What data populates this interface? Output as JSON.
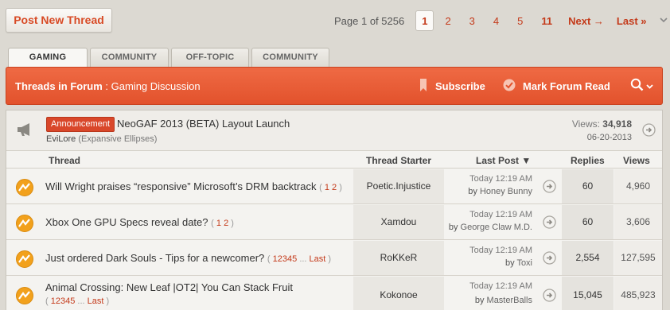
{
  "post_button": "Post New Thread",
  "pager": {
    "info": "Page 1 of 5256",
    "pages": [
      "1",
      "2",
      "3",
      "4",
      "5",
      "11"
    ],
    "next": "Next →",
    "last": "Last »",
    "chevron": "⌄"
  },
  "tabs": [
    "GAMING",
    "COMMUNITY",
    "OFF-TOPIC",
    "COMMUNITY"
  ],
  "forum_bar": {
    "prefix": "Threads in Forum",
    "separator": " : ",
    "forum_name": "Gaming Discussion",
    "subscribe": "Subscribe",
    "mark_read": "Mark Forum Read"
  },
  "announcement": {
    "badge": "Announcement",
    "title": "NeoGAF 2013 (BETA) Layout Launch",
    "author": "EviLore",
    "author_sub": "(Expansive Ellipses)",
    "views_label": "Views:",
    "views": "34,918",
    "date": "06-20-2013"
  },
  "columns": {
    "thread": "Thread",
    "starter": "Thread Starter",
    "last_post": "Last Post ▼",
    "replies": "Replies",
    "views": "Views"
  },
  "threads": [
    {
      "title": "Will Wright praises “responsive” Microsoft’s DRM backtrack",
      "pages": [
        "1",
        "2"
      ],
      "pages_last": "",
      "starter": "Poetic.Injustice",
      "last_time": "Today 12:19 AM",
      "last_by_prefix": "by",
      "last_by": "Honey Bunny",
      "replies": "60",
      "views": "4,960"
    },
    {
      "title": "Xbox One GPU Specs reveal date?",
      "pages": [
        "1",
        "2"
      ],
      "pages_last": "",
      "starter": "Xamdou",
      "last_time": "Today 12:19 AM",
      "last_by_prefix": "by",
      "last_by": "George Claw M.D.",
      "replies": "60",
      "views": "3,606"
    },
    {
      "title": "Just ordered Dark Souls - Tips for a newcomer?",
      "pages": [
        "1",
        "2",
        "3",
        "4",
        "5"
      ],
      "pages_last": "Last",
      "starter": "RoKKeR",
      "last_time": "Today 12:19 AM",
      "last_by_prefix": "by",
      "last_by": "Toxi",
      "replies": "2,554",
      "views": "127,595"
    },
    {
      "title": "Animal Crossing: New Leaf |OT2| You Can Stack Fruit",
      "pages": [
        "1",
        "2",
        "3",
        "4",
        "5"
      ],
      "pages_last": "Last",
      "starter": "Kokonoe",
      "last_time": "Today 12:19 AM",
      "last_by_prefix": "by",
      "last_by": "MasterBalls",
      "replies": "15,045",
      "views": "485,923"
    }
  ],
  "colors": {
    "accent": "#e55a33",
    "link": "#c43a1a",
    "icon_orange": "#f2a11c",
    "background": "#dcd9d2"
  },
  "icons": {
    "subscribe": "bookmark-icon",
    "mark_read": "check-circle-icon",
    "search": "search-icon",
    "announcement": "megaphone-icon",
    "thread": "hot-thread-icon",
    "go_last": "arrow-circle-icon"
  }
}
